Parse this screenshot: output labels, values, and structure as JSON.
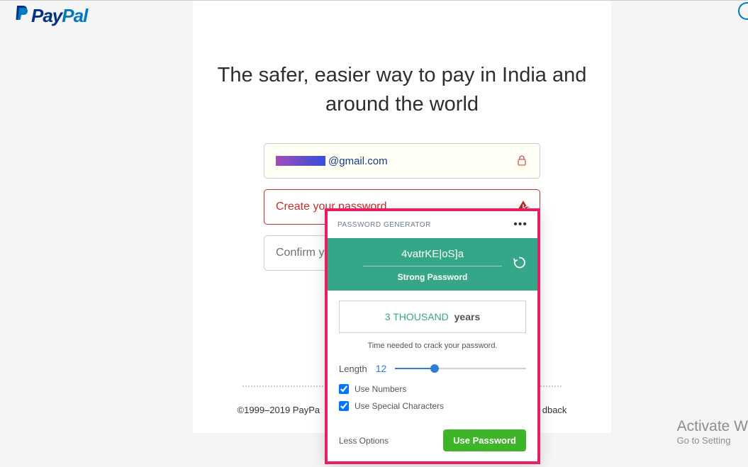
{
  "logo": {
    "part1": "Pay",
    "part2": "Pal"
  },
  "headline": "The safer, easier way to pay in India and around the world",
  "email_field": {
    "suffix": "@gmail.com"
  },
  "password_field": {
    "placeholder": "Create your password"
  },
  "confirm_field": {
    "placeholder": "Confirm y"
  },
  "footer": {
    "copyright": "©1999–2019 PayPa",
    "feedback_tail": "dback"
  },
  "pwgen": {
    "title": "PASSWORD GENERATOR",
    "password": "4vatrKE|oS]a",
    "strength": "Strong Password",
    "crack_prefix": "3 THOUSAND",
    "crack_unit": "years",
    "crack_hint": "Time needed to crack your password.",
    "length_label": "Length",
    "length_value": "12",
    "use_numbers": "Use Numbers",
    "use_special": "Use Special Characters",
    "less_options": "Less Options",
    "use_button": "Use Password"
  },
  "watermark": {
    "title": "Activate W",
    "sub": "Go to Setting"
  }
}
